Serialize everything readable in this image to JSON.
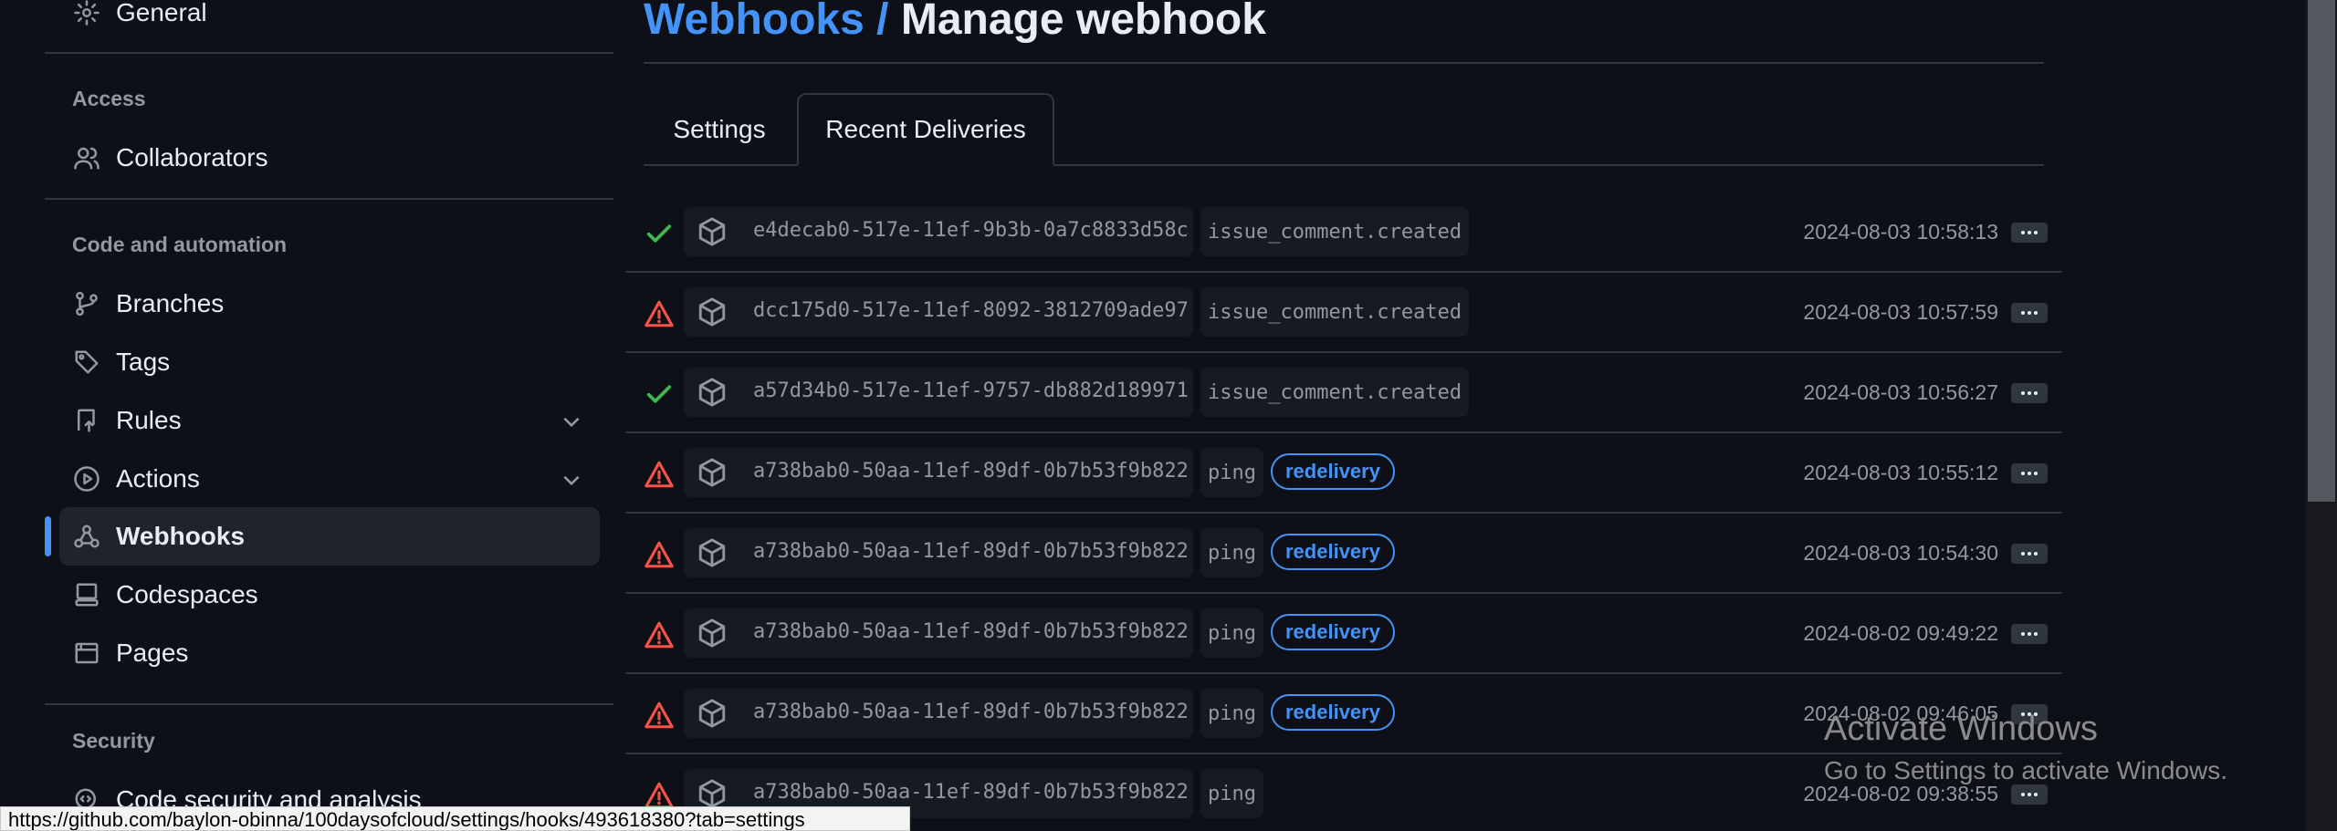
{
  "sidebar": {
    "general": "General",
    "access_heading": "Access",
    "collaborators": "Collaborators",
    "code_heading": "Code and automation",
    "branches": "Branches",
    "tags": "Tags",
    "rules": "Rules",
    "actions": "Actions",
    "webhooks": "Webhooks",
    "codespaces": "Codespaces",
    "pages": "Pages",
    "security_heading": "Security",
    "code_security": "Code security and analysis"
  },
  "header": {
    "crumb": "Webhooks",
    "separator": "/",
    "title": "Manage webhook"
  },
  "tabs": {
    "settings": "Settings",
    "recent_deliveries": "Recent Deliveries"
  },
  "deliveries": [
    {
      "status": "success",
      "guid": "e4decab0-517e-11ef-9b3b-0a7c8833d58c",
      "event": "issue_comment.created",
      "redelivery": "",
      "timestamp": "2024-08-03 10:58:13"
    },
    {
      "status": "failure",
      "guid": "dcc175d0-517e-11ef-8092-3812709ade97",
      "event": "issue_comment.created",
      "redelivery": "",
      "timestamp": "2024-08-03 10:57:59"
    },
    {
      "status": "success",
      "guid": "a57d34b0-517e-11ef-9757-db882d189971",
      "event": "issue_comment.created",
      "redelivery": "",
      "timestamp": "2024-08-03 10:56:27"
    },
    {
      "status": "failure",
      "guid": "a738bab0-50aa-11ef-89df-0b7b53f9b822",
      "event": "ping",
      "redelivery": "redelivery",
      "timestamp": "2024-08-03 10:55:12"
    },
    {
      "status": "failure",
      "guid": "a738bab0-50aa-11ef-89df-0b7b53f9b822",
      "event": "ping",
      "redelivery": "redelivery",
      "timestamp": "2024-08-03 10:54:30"
    },
    {
      "status": "failure",
      "guid": "a738bab0-50aa-11ef-89df-0b7b53f9b822",
      "event": "ping",
      "redelivery": "redelivery",
      "timestamp": "2024-08-02 09:49:22"
    },
    {
      "status": "failure",
      "guid": "a738bab0-50aa-11ef-89df-0b7b53f9b822",
      "event": "ping",
      "redelivery": "redelivery",
      "timestamp": "2024-08-02 09:46:05"
    },
    {
      "status": "failure",
      "guid": "a738bab0-50aa-11ef-89df-0b7b53f9b822",
      "event": "ping",
      "redelivery": "",
      "timestamp": "2024-08-02 09:38:55"
    }
  ],
  "watermark": {
    "title": "Activate Windows",
    "subtitle": "Go to Settings to activate Windows."
  },
  "status_url": "https://github.com/baylon-obinna/100daysofcloud/settings/hooks/493618380?tab=settings",
  "colors": {
    "accent": "#4493f8",
    "success": "#3fb950",
    "failure": "#f85149",
    "background": "#0d1117"
  }
}
